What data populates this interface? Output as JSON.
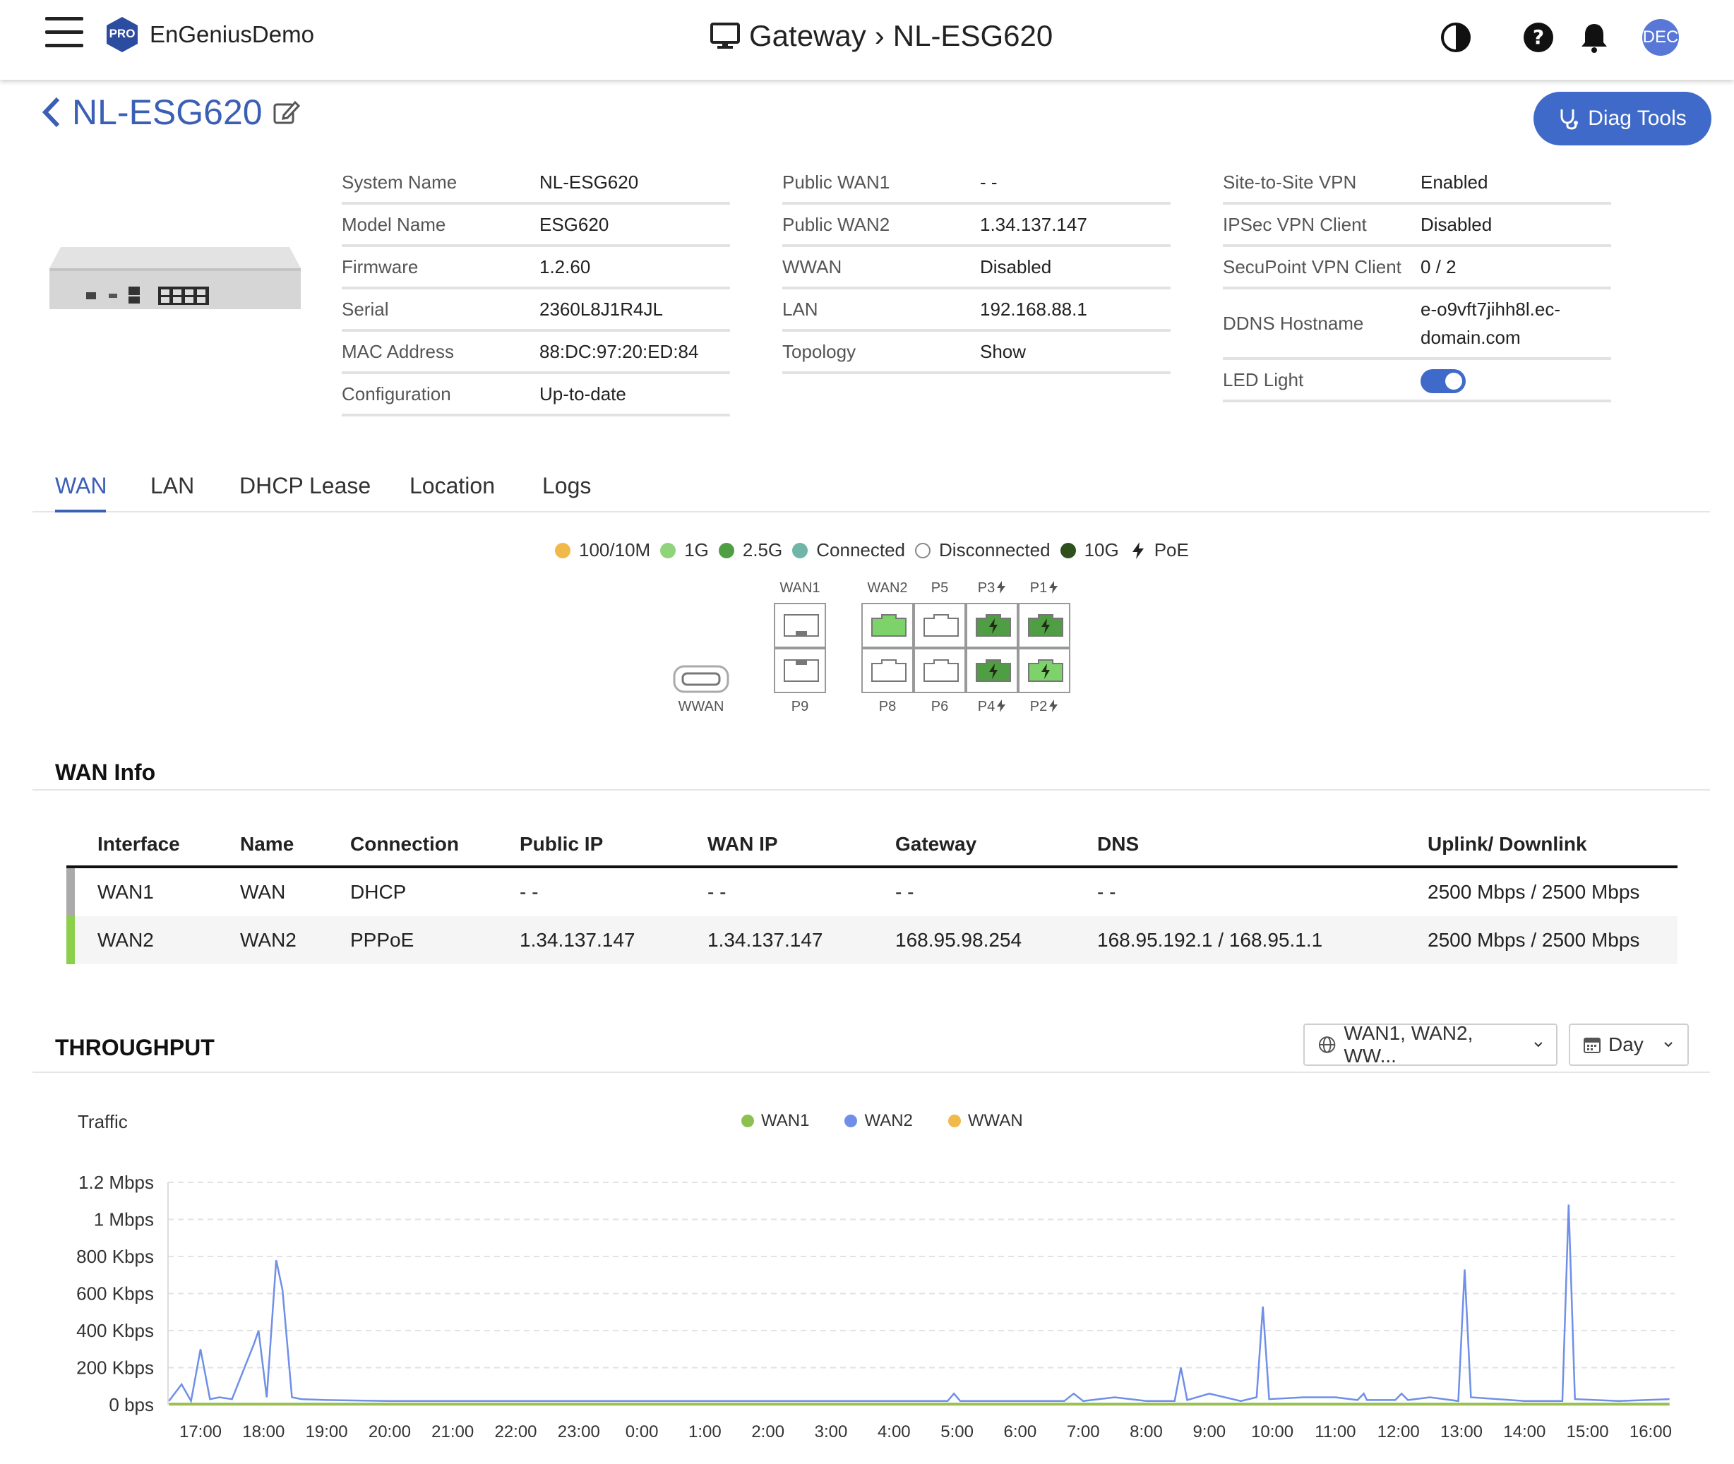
{
  "topbar": {
    "org_badge": "PRO",
    "org_name": "EnGeniusDemo",
    "breadcrumb_parent": "Gateway",
    "breadcrumb_sep": "›",
    "breadcrumb_current": "NL-ESG620",
    "avatar": "DEC"
  },
  "header": {
    "device_name": "NL-ESG620",
    "diag_label": "Diag Tools"
  },
  "info_col1": [
    {
      "k": "System Name",
      "v": "NL-ESG620"
    },
    {
      "k": "Model Name",
      "v": "ESG620"
    },
    {
      "k": "Firmware",
      "v": "1.2.60"
    },
    {
      "k": "Serial",
      "v": "2360L8J1R4JL"
    },
    {
      "k": "MAC Address",
      "v": "88:DC:97:20:ED:84"
    },
    {
      "k": "Configuration",
      "v": "Up-to-date"
    }
  ],
  "info_col2": [
    {
      "k": "Public WAN1",
      "v": "- -"
    },
    {
      "k": "Public WAN2",
      "v": "1.34.137.147"
    },
    {
      "k": "WWAN",
      "v": "Disabled"
    },
    {
      "k": "LAN",
      "v": "192.168.88.1"
    },
    {
      "k": "Topology",
      "v": "Show"
    }
  ],
  "info_col3": [
    {
      "k": "Site-to-Site VPN",
      "v": "Enabled"
    },
    {
      "k": "IPSec VPN Client",
      "v": "Disabled"
    },
    {
      "k": "SecuPoint VPN Client",
      "v": "0 / 2"
    },
    {
      "k": "DDNS Hostname",
      "v": "e-o9vft7jihh8l.ec-domain.com"
    },
    {
      "k": "LED Light",
      "v": ""
    }
  ],
  "led_light_on": true,
  "tabs": [
    "WAN",
    "LAN",
    "DHCP Lease",
    "Location",
    "Logs"
  ],
  "legend": [
    {
      "label": "100/10M",
      "color": "#f0b94a"
    },
    {
      "label": "1G",
      "color": "#8fd37a"
    },
    {
      "label": "2.5G",
      "color": "#4f9e43"
    },
    {
      "label": "Connected",
      "color": "#6fb5a8"
    },
    {
      "label": "Disconnected",
      "color": "#ffffff"
    },
    {
      "label": "10G",
      "color": "#2f4f1d"
    },
    {
      "label": "PoE",
      "color": ""
    }
  ],
  "ports": {
    "wwan": "WWAN",
    "wan1": "WAN1",
    "p9": "P9",
    "wan2": "WAN2",
    "p5": "P5",
    "p3": "P3",
    "p1": "P1",
    "p8": "P8",
    "p6": "P6",
    "p4": "P4",
    "p2": "P2"
  },
  "wan_info": {
    "title": "WAN Info",
    "headers": [
      "Interface",
      "Name",
      "Connection",
      "Public IP",
      "WAN IP",
      "Gateway",
      "DNS",
      "Uplink/ Downlink"
    ],
    "rows": [
      {
        "cells": [
          "WAN1",
          "WAN",
          "DHCP",
          "- -",
          "- -",
          "- -",
          "- -",
          "2500 Mbps / 2500 Mbps"
        ],
        "bar": "#aaaaaa"
      },
      {
        "cells": [
          "WAN2",
          "WAN2",
          "PPPoE",
          "1.34.137.147",
          "1.34.137.147",
          "168.95.98.254",
          "168.95.192.1 / 168.95.1.1",
          "2500 Mbps / 2500 Mbps"
        ],
        "bar": "#8ccf4d"
      }
    ]
  },
  "throughput": {
    "title": "THROUGHPUT",
    "interface_select": "WAN1, WAN2, WW...",
    "range_select": "Day"
  },
  "chart_data": {
    "type": "line",
    "title": "Traffic",
    "yticks": [
      "0 bps",
      "200 Kbps",
      "400 Kbps",
      "600 Kbps",
      "800 Kbps",
      "1 Mbps",
      "1.2 Mbps"
    ],
    "xticks": [
      "17:00",
      "18:00",
      "19:00",
      "20:00",
      "21:00",
      "22:00",
      "23:00",
      "0:00",
      "1:00",
      "2:00",
      "3:00",
      "4:00",
      "5:00",
      "6:00",
      "7:00",
      "8:00",
      "9:00",
      "10:00",
      "11:00",
      "12:00",
      "13:00",
      "14:00",
      "15:00",
      "16:00"
    ],
    "ylim": [
      0,
      1200
    ],
    "yunit": "Kbps",
    "x_hours_from_1700": [
      -0.5,
      -0.3,
      -0.15,
      0.0,
      0.15,
      0.3,
      0.5,
      0.85,
      0.92,
      1.05,
      1.2,
      1.3,
      1.45,
      1.6,
      2.0,
      3.0,
      4.0,
      5.0,
      6.0,
      7.0,
      8.0,
      9.0,
      10.0,
      11.0,
      11.85,
      11.95,
      12.05,
      12.5,
      13.0,
      13.7,
      13.85,
      14.0,
      14.5,
      15.0,
      15.45,
      15.55,
      15.65,
      16.0,
      16.5,
      16.75,
      16.85,
      16.95,
      17.5,
      18.0,
      18.35,
      18.45,
      18.5,
      18.95,
      19.05,
      19.15,
      19.5,
      19.95,
      20.05,
      20.15,
      21.0,
      21.6,
      21.7,
      21.8,
      22.5,
      23.3
    ],
    "series": [
      {
        "name": "WAN1",
        "color": "#8cc152",
        "values": [
          5,
          5,
          5,
          5,
          5,
          5,
          5,
          5,
          5,
          5,
          5,
          5,
          5,
          5,
          5,
          5,
          5,
          5,
          5,
          5,
          5,
          5,
          5,
          5,
          5,
          5,
          5,
          5,
          5,
          5,
          5,
          5,
          5,
          5,
          5,
          5,
          5,
          5,
          5,
          5,
          5,
          5,
          5,
          5,
          5,
          5,
          5,
          5,
          5,
          5,
          5,
          5,
          5,
          5,
          5,
          5,
          5,
          5,
          5,
          5
        ]
      },
      {
        "name": "WAN2",
        "color": "#6f8fe8",
        "values": [
          20,
          110,
          20,
          300,
          30,
          40,
          30,
          330,
          400,
          40,
          780,
          620,
          40,
          30,
          25,
          20,
          20,
          20,
          20,
          20,
          20,
          20,
          20,
          20,
          20,
          60,
          20,
          20,
          20,
          20,
          60,
          20,
          40,
          20,
          20,
          200,
          25,
          60,
          20,
          40,
          530,
          30,
          40,
          40,
          25,
          60,
          25,
          25,
          60,
          25,
          40,
          20,
          730,
          40,
          20,
          20,
          1080,
          30,
          20,
          30
        ]
      },
      {
        "name": "WWAN",
        "color": "#f0b94a",
        "values": [
          0,
          0,
          0,
          0,
          0,
          0,
          0,
          0,
          0,
          0,
          0,
          0,
          0,
          0,
          0,
          0,
          0,
          0,
          0,
          0,
          0,
          0,
          0,
          0,
          0,
          0,
          0,
          0,
          0,
          0,
          0,
          0,
          0,
          0,
          0,
          0,
          0,
          0,
          0,
          0,
          0,
          0,
          0,
          0,
          0,
          0,
          0,
          0,
          0,
          0,
          0,
          0,
          0,
          0,
          0,
          0,
          0,
          0,
          0,
          0
        ]
      }
    ]
  }
}
